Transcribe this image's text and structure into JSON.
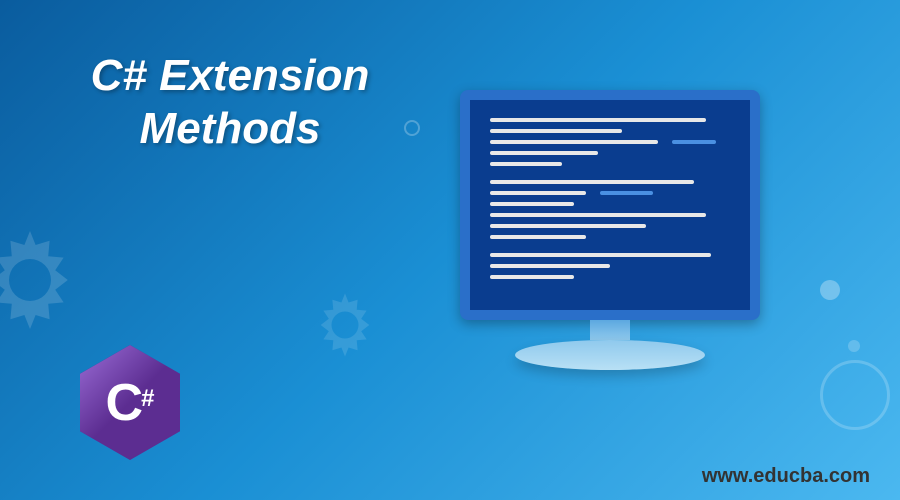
{
  "title_line1": "C# Extension",
  "title_line2": "Methods",
  "website_url": "www.educba.com",
  "logo": {
    "main_letter": "C",
    "hash": "#"
  },
  "colors": {
    "screen_bg": "#0a3d8f",
    "line_white": "#e8e8e8",
    "line_blue": "#4a90e2"
  },
  "code_lines": [
    {
      "width": "90%",
      "color": "white"
    },
    {
      "width": "55%",
      "color": "white"
    },
    {
      "width": "70%",
      "color": "white",
      "extra": {
        "width": "18%",
        "color": "blue",
        "marginLeft": "6%"
      }
    },
    {
      "width": "45%",
      "color": "white"
    },
    {
      "width": "30%",
      "color": "white",
      "gap": true
    },
    {
      "width": "85%",
      "color": "white"
    },
    {
      "width": "40%",
      "color": "white",
      "extra": {
        "width": "22%",
        "color": "blue",
        "marginLeft": "6%"
      }
    },
    {
      "width": "35%",
      "color": "white"
    },
    {
      "width": "90%",
      "color": "white"
    },
    {
      "width": "65%",
      "color": "white"
    },
    {
      "width": "40%",
      "color": "white",
      "gap": true
    },
    {
      "width": "92%",
      "color": "white"
    },
    {
      "width": "50%",
      "color": "white"
    },
    {
      "width": "35%",
      "color": "white"
    }
  ]
}
